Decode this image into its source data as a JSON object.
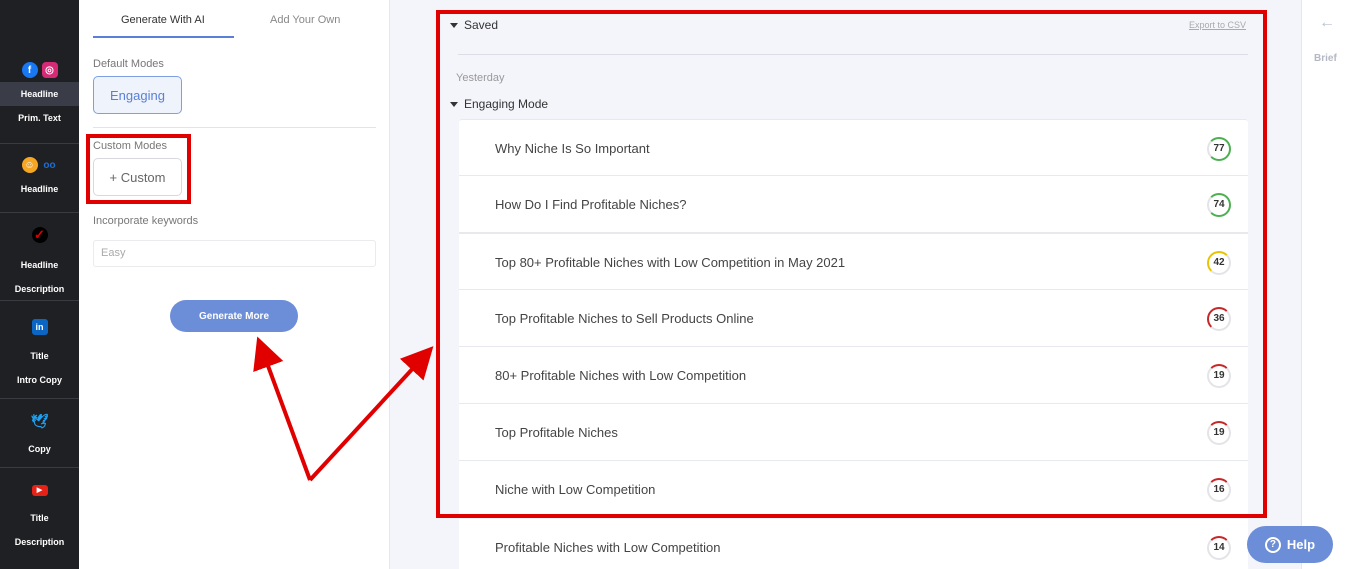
{
  "nav": {
    "groups": [
      {
        "icons": [
          "facebook-icon",
          "instagram-icon"
        ],
        "items": [
          "Headline",
          "Prim. Text"
        ],
        "active": 0
      },
      {
        "icons": [
          "taboola-icon",
          "outbrain-icon"
        ],
        "items": [
          "Headline"
        ]
      },
      {
        "icons": [
          "verizon-icon"
        ],
        "items": [
          "Headline",
          "Description"
        ]
      },
      {
        "icons": [
          "linkedin-icon"
        ],
        "items": [
          "Title",
          "Intro Copy"
        ]
      },
      {
        "icons": [
          "twitter-icon"
        ],
        "items": [
          "Copy"
        ]
      },
      {
        "icons": [
          "youtube-icon"
        ],
        "items": [
          "Title",
          "Description"
        ]
      }
    ]
  },
  "panel": {
    "tabs": [
      "Generate With AI",
      "Add Your Own"
    ],
    "default_modes_label": "Default Modes",
    "engaging_label": "Engaging",
    "custom_modes_label": "Custom Modes",
    "custom_label": "+ Custom",
    "keywords_label": "Incorporate keywords",
    "keywords_placeholder": "Easy",
    "generate_label": "Generate More"
  },
  "main": {
    "saved_label": "Saved",
    "export_label": "Export to CSV",
    "yesterday_label": "Yesterday",
    "mode_label": "Engaging Mode",
    "results": [
      {
        "text": "Why Niche Is So Important",
        "score": 77
      },
      {
        "text": "How Do I Find Profitable Niches?",
        "score": 74
      },
      {
        "text": "Top 80+ Profitable Niches with Low Competition in May 2021",
        "score": 42
      },
      {
        "text": "Top Profitable Niches to Sell Products Online",
        "score": 36
      },
      {
        "text": "80+ Profitable Niches with Low Competition",
        "score": 19
      },
      {
        "text": "Top Profitable Niches",
        "score": 19
      },
      {
        "text": "Niche with Low Competition",
        "score": 16
      },
      {
        "text": "Profitable Niches with Low Competition",
        "score": 14
      }
    ]
  },
  "right": {
    "brief_label": "Brief",
    "help_label": "Help"
  },
  "colors": {
    "accent": "#6c8ed8",
    "annotation": "#e00000",
    "score_high": "#4caf50",
    "score_mid": "#e8c400",
    "score_low": "#c62828"
  }
}
